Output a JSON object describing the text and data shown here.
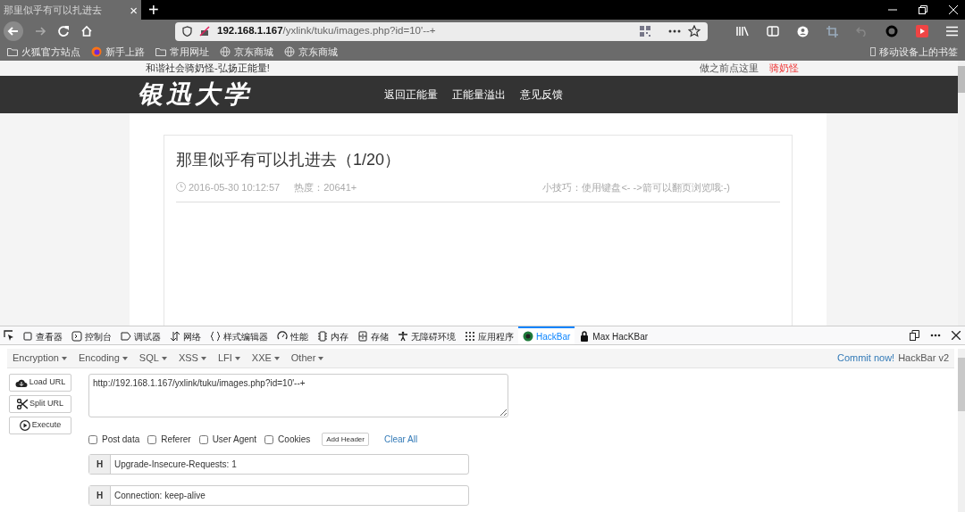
{
  "browser": {
    "tab": {
      "title": "那里似乎有可以扎进去",
      "close": "×"
    },
    "new_tab": "+",
    "url": {
      "host": "192.168.1.167",
      "path": "/yxlink/tuku/images.php?id=10'--+"
    },
    "bookmarks": [
      "火狐官方站点",
      "新手上路",
      "常用网址",
      "京东商城",
      "京东商城"
    ],
    "mobile_bookmarks": "移动设备上的书签"
  },
  "site": {
    "slogan": "和谐社会骑奶怪-弘扬正能量!",
    "login_prompt": "做之前点这里",
    "user": "骑奶怪",
    "logo": "银迅大学",
    "nav": [
      "返回正能量",
      "正能量溢出",
      "意见反馈"
    ],
    "article": {
      "title": "那里似乎有可以扎进去（1/20）",
      "date": "2016-05-30 10:12:57",
      "heat": "热度：20641+",
      "tip": "小技巧：使用键盘<- ->箭可以翻页浏览哦:-)"
    }
  },
  "devtools": {
    "tabs": [
      {
        "label": "查看器",
        "selected": false
      },
      {
        "label": "控制台",
        "selected": false
      },
      {
        "label": "调试器",
        "selected": false
      },
      {
        "label": "网络",
        "selected": false
      },
      {
        "label": "样式编辑器",
        "selected": false
      },
      {
        "label": "性能",
        "selected": false
      },
      {
        "label": "内存",
        "selected": false
      },
      {
        "label": "存储",
        "selected": false
      },
      {
        "label": "无障碍环境",
        "selected": false
      },
      {
        "label": "应用程序",
        "selected": false
      },
      {
        "label": "HackBar",
        "selected": true
      },
      {
        "label": "Max HacKBar",
        "selected": false
      }
    ]
  },
  "hackbar": {
    "menus": [
      "Encryption",
      "Encoding",
      "SQL",
      "XSS",
      "LFI",
      "XXE",
      "Other"
    ],
    "commit": "Commit now!",
    "version": "HackBar v2",
    "actions": [
      "Load URL",
      "Split URL",
      "Execute"
    ],
    "url_value": "http://192.168.1.167/yxlink/tuku/images.php?id=10'--+",
    "options": [
      {
        "label": "Post data",
        "checked": false
      },
      {
        "label": "Referer",
        "checked": false
      },
      {
        "label": "User Agent",
        "checked": false
      },
      {
        "label": "Cookies",
        "checked": false
      }
    ],
    "add_header": "Add Header",
    "clear_all": "Clear All",
    "headers": [
      {
        "tag": "H",
        "value": "Upgrade-Insecure-Requests: 1"
      },
      {
        "tag": "H",
        "value": "Connection: keep-alive"
      }
    ]
  }
}
